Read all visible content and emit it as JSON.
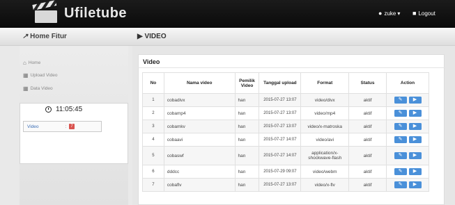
{
  "header": {
    "logo_text": "Ufiletube",
    "user_name": "zuke",
    "user_caret": "▾",
    "logout_label": "Logout"
  },
  "subheader": {
    "home_fitur_label": "Home Fitur",
    "section_title": "VIDEO"
  },
  "sidebar": {
    "items": [
      {
        "label": "Home",
        "icon": "home-icon"
      },
      {
        "label": "Upload Video",
        "icon": "film-icon"
      },
      {
        "label": "Data Video",
        "icon": "film-icon"
      }
    ],
    "clock": "11:05:45",
    "counter": {
      "label": "Video",
      "colon": ":",
      "count": "7"
    }
  },
  "panel": {
    "title": "Video",
    "columns": [
      "No",
      "Nama video",
      "Pemilik Video",
      "Tanggal upload",
      "Format",
      "Status",
      "Action"
    ],
    "rows": [
      {
        "no": "1",
        "name": "cobadivx",
        "owner": "han",
        "date": "2015-07-27 13:07",
        "format": "video/divx",
        "status": "aktif"
      },
      {
        "no": "2",
        "name": "cobamp4",
        "owner": "han",
        "date": "2015-07-27 13:07",
        "format": "video/mp4",
        "status": "aktif"
      },
      {
        "no": "3",
        "name": "cobamkv",
        "owner": "han",
        "date": "2015-07-27 13:07",
        "format": "video/x-matroska",
        "status": "aktif"
      },
      {
        "no": "4",
        "name": "cobaavi",
        "owner": "han",
        "date": "2015-07-27 14:07",
        "format": "video/avi",
        "status": "aktif"
      },
      {
        "no": "5",
        "name": "cobaswf",
        "owner": "han",
        "date": "2015-07-27 14:07",
        "format": "application/x-shockwave-flash",
        "status": "aktif"
      },
      {
        "no": "6",
        "name": "dddcc",
        "owner": "han",
        "date": "2015-07-29 09:07",
        "format": "video/webm",
        "status": "aktif"
      },
      {
        "no": "7",
        "name": "cobaflv",
        "owner": "han",
        "date": "2015-07-27 13:07",
        "format": "video/x-flv",
        "status": "aktif"
      }
    ],
    "edit_icon": "edit-icon",
    "play_icon": "play-icon"
  },
  "colors": {
    "accent": "#4a90d9",
    "badge": "#d9534f",
    "topbar": "#111111"
  }
}
